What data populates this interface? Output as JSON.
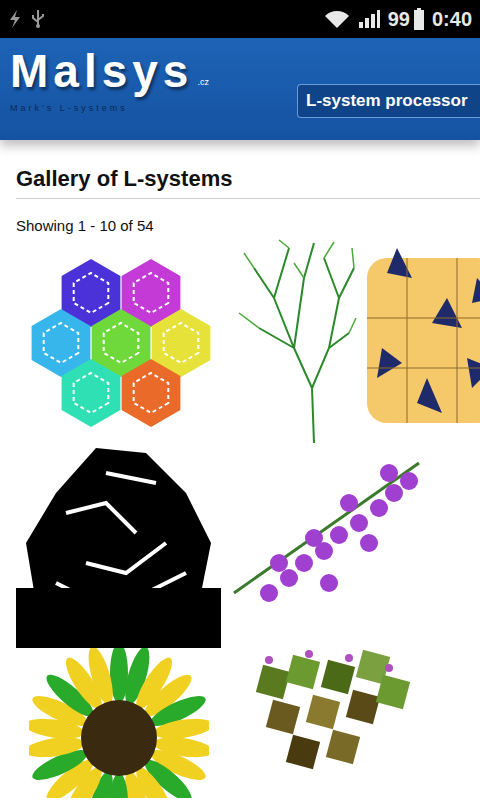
{
  "status_bar": {
    "battery": "99",
    "time": "0:40"
  },
  "header": {
    "logo": "Malsys",
    "logo_suffix": ".cz",
    "tagline": "Mark's L-systems",
    "nav_button": "L-system processor"
  },
  "gallery": {
    "title": "Gallery of L-systems",
    "count": "Showing 1 - 10 of 54",
    "thumbnails": [
      {
        "kind": "hexagon"
      },
      {
        "kind": "tree"
      },
      {
        "kind": "penrose"
      },
      {
        "kind": "gosper"
      },
      {
        "kind": "lavender"
      },
      {
        "kind": "sunflower"
      },
      {
        "kind": "bush"
      }
    ]
  }
}
